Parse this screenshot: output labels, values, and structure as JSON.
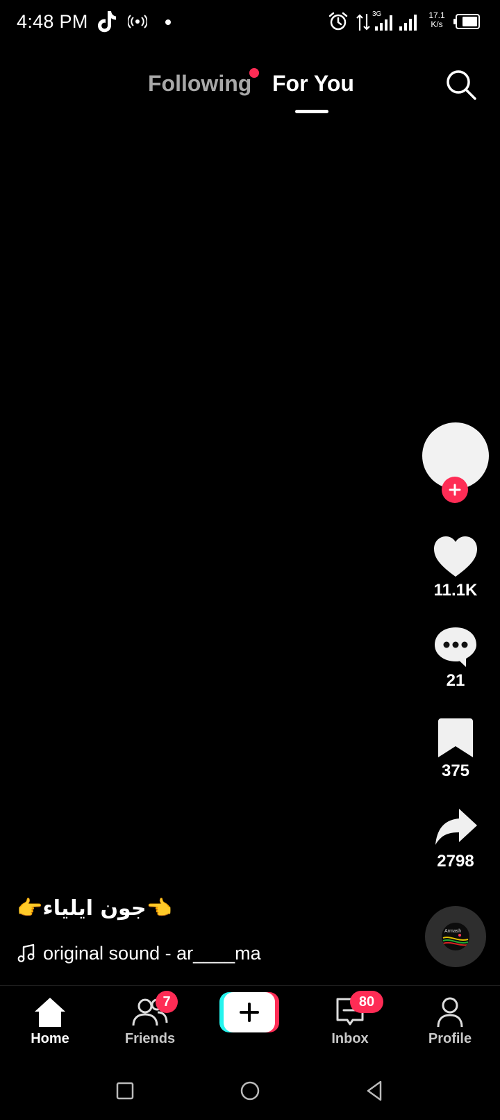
{
  "status_bar": {
    "time": "4:48 PM",
    "network_label": "3G",
    "speed_value": "17.1",
    "speed_unit": "K/s",
    "icons": [
      "tiktok-icon",
      "hotspot-icon",
      "alarm-icon",
      "data-arrows-icon",
      "signal-icon",
      "battery-icon"
    ]
  },
  "top_nav": {
    "tabs": [
      {
        "label": "Following",
        "active": false,
        "has_dot": true
      },
      {
        "label": "For You",
        "active": true
      }
    ],
    "search_icon": "search-icon"
  },
  "actions": {
    "likes": "11.1K",
    "comments": "21",
    "saves": "375",
    "shares": "2798"
  },
  "video": {
    "caption": "👉جون ايلياء👈",
    "sound": "original sound - ar____ma",
    "disc_label": "Armash"
  },
  "bottom_nav": {
    "items": [
      {
        "label": "Home",
        "icon": "home-icon",
        "active": true
      },
      {
        "label": "Friends",
        "icon": "friends-icon",
        "badge": "7"
      },
      {
        "label": "",
        "icon": "plus-icon"
      },
      {
        "label": "Inbox",
        "icon": "inbox-icon",
        "badge": "80"
      },
      {
        "label": "Profile",
        "icon": "profile-icon"
      }
    ]
  },
  "colors": {
    "accent": "#fe2c55",
    "cyan": "#25f4ee",
    "background": "#000000",
    "inactive_tab": "#a8a8a8"
  }
}
